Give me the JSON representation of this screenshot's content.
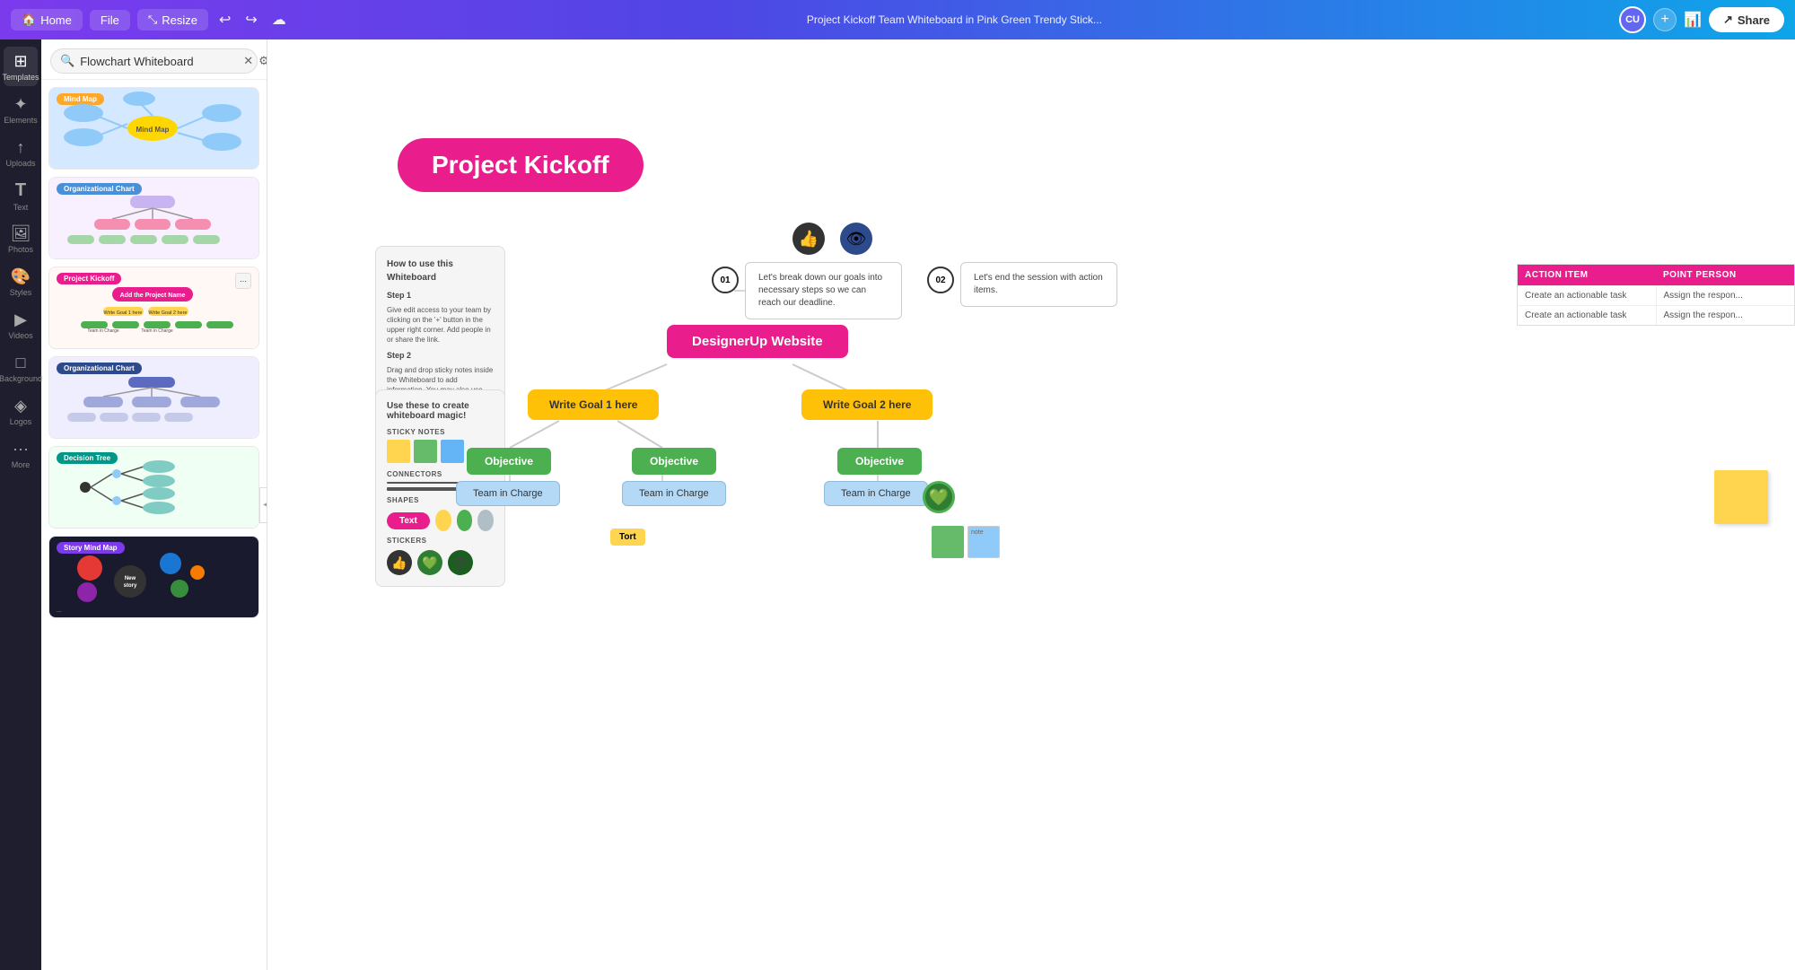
{
  "topbar": {
    "home_label": "Home",
    "file_label": "File",
    "resize_label": "Resize",
    "title": "Project Kickoff Team Whiteboard in Pink Green Trendy Stick...",
    "share_label": "Share"
  },
  "sidebar": {
    "items": [
      {
        "id": "templates",
        "label": "Templates",
        "icon": "⊞"
      },
      {
        "id": "elements",
        "label": "Elements",
        "icon": "✦"
      },
      {
        "id": "uploads",
        "label": "Uploads",
        "icon": "↑"
      },
      {
        "id": "text",
        "label": "Text",
        "icon": "T"
      },
      {
        "id": "photos",
        "label": "Photos",
        "icon": "🖼"
      },
      {
        "id": "styles",
        "label": "Styles",
        "icon": "🎨"
      },
      {
        "id": "videos",
        "label": "Videos",
        "icon": "▶"
      },
      {
        "id": "background",
        "label": "Background",
        "icon": "□"
      },
      {
        "id": "logos",
        "label": "Logos",
        "icon": "◈"
      },
      {
        "id": "more",
        "label": "More",
        "icon": "···"
      }
    ]
  },
  "templates_panel": {
    "search_placeholder": "Flowchart Whiteboard",
    "templates": [
      {
        "id": "mindmap",
        "label": "Mind Map",
        "label_color": "orange"
      },
      {
        "id": "orgchart1",
        "label": "Organizational Chart",
        "label_color": "blue"
      },
      {
        "id": "projkick",
        "label": "Project Kickoff",
        "label_color": "pink"
      },
      {
        "id": "orgchart2",
        "label": "Organizational Chart",
        "label_color": "darkblue"
      },
      {
        "id": "decision",
        "label": "Decision Tree",
        "label_color": "teal"
      },
      {
        "id": "storymind",
        "label": "Story Mind Map",
        "label_color": "purple"
      }
    ]
  },
  "canvas": {
    "project_kickoff_title": "Project Kickoff",
    "howto_title": "How to use this Whiteboard",
    "step1_title": "Step 1",
    "step1_text": "Give edit access to your team by clicking on the '+' button in the upper right corner. Add people in or share the link.",
    "step2_title": "Step 2",
    "step2_text": "Drag and drop sticky notes inside the Whiteboard to add information. You may also use the arrows to connect ideas. And add more shapes to expand your map.",
    "create_title": "Use these to create whiteboard magic!",
    "sticky_notes_label": "STICKY NOTES",
    "connectors_label": "CONNECTORS",
    "shapes_label": "SHAPES",
    "shape_text": "Text",
    "stickers_label": "STICKERS",
    "step01": "01",
    "step01_text": "Let's break down our goals into necessary steps so we can reach our deadline.",
    "step02": "02",
    "step02_text": "Let's end the session with action items.",
    "designer_up": "DesignerUp Website",
    "goal1": "Write Goal 1 here",
    "goal2": "Write Goal 2 here",
    "objective1": "Objective",
    "objective2": "Objective",
    "objective3": "Objective",
    "team1": "Team in Charge",
    "team2": "Team in Charge",
    "team3": "Team in Charge",
    "action_col1": "ACTION ITEM",
    "action_col2": "POINT PERSON",
    "action_row1_col1": "Create an actionable task",
    "action_row1_col2": "Assign the respon...",
    "action_row2_col1": "Create an actionable task",
    "action_row2_col2": "Assign the respon...",
    "tort_label": "Tort"
  }
}
